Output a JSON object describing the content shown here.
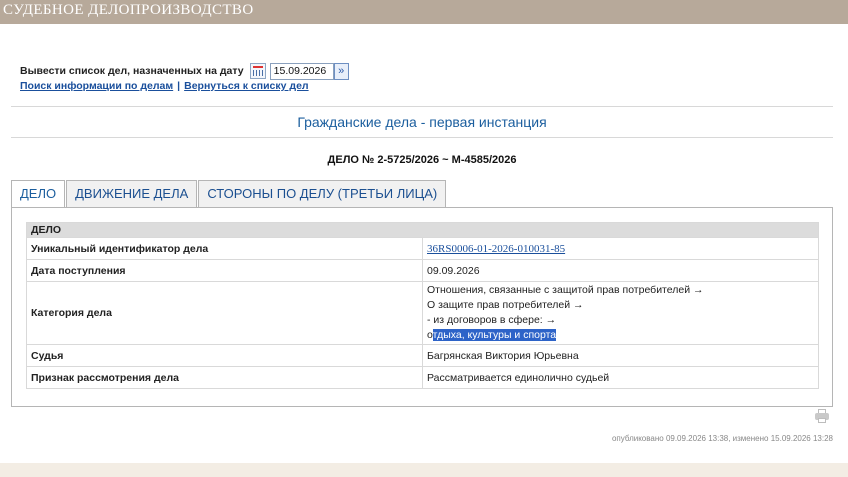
{
  "header": {
    "title": "СУДЕБНОЕ ДЕЛОПРОИЗВОДСТВО"
  },
  "filter": {
    "label": "Вывести список дел, назначенных на дату",
    "date_value": "15.09.2026",
    "calendar_icon": "calendar-icon",
    "go_icon": "double-chevron-right-icon",
    "go_glyph": "»"
  },
  "links": {
    "search": "Поиск информации по делам",
    "separator": "|",
    "back": "Вернуться к списку дел"
  },
  "section_title": "Гражданские дела - первая инстанция",
  "case_title": "ДЕЛО № 2-5725/2026 ~ М-4585/2026",
  "tabs": [
    {
      "label": "ДЕЛО",
      "active": true
    },
    {
      "label": "ДВИЖЕНИЕ ДЕЛА",
      "active": false
    },
    {
      "label": "СТОРОНЫ ПО ДЕЛУ (ТРЕТЬИ ЛИЦА)",
      "active": false
    }
  ],
  "case_table": {
    "header": "ДЕЛО",
    "rows": [
      {
        "key": "Уникальный идентификатор дела",
        "value": "36RS0006-01-2026-010031-85"
      },
      {
        "key": "Дата поступления",
        "value": "09.09.2026"
      },
      {
        "key": "Категория дела",
        "lines": [
          "Отношения, связанные с защитой прав потребителей →",
          "О защите прав потребителей →",
          "- из договоров в сфере: →"
        ],
        "last_line_plain": "о",
        "last_line_selected": "тдыха, культуры и спорта"
      },
      {
        "key": "Судья",
        "value": "Багрянская Виктория Юрьевна"
      },
      {
        "key": "Признак рассмотрения дела",
        "value": "Рассматривается единолично судьей"
      }
    ]
  },
  "print_icon": "printer-icon",
  "published": "опубликовано 09.09.2026 13:38, изменено 15.09.2026 13:28",
  "colors": {
    "header_bg": "#b7a99a",
    "link": "#1a4f9c",
    "title_blue": "#1b5e9e",
    "selection": "#2d63c8",
    "footer_bg": "#f3ede4"
  }
}
